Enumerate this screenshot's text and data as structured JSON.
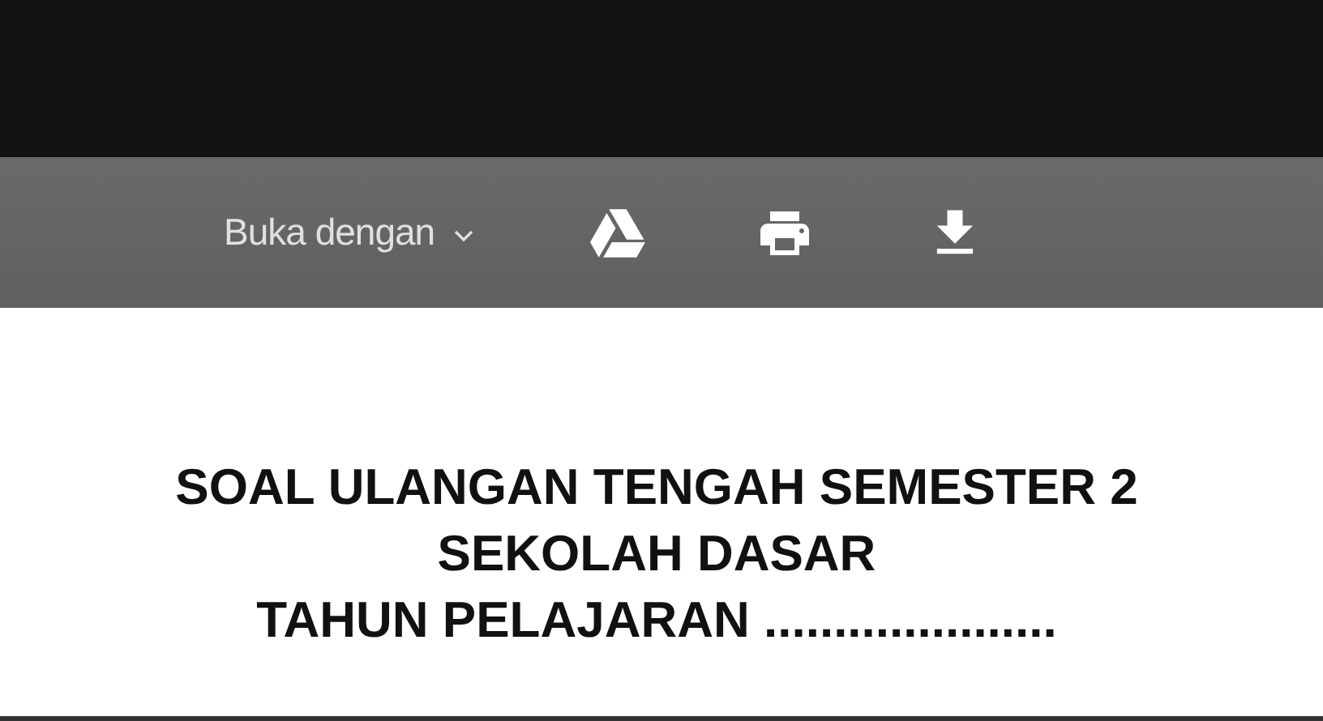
{
  "toolbar": {
    "open_with": {
      "label": "Buka dengan"
    }
  },
  "document": {
    "title_lines": [
      "SOAL ULANGAN TENGAH SEMESTER 2",
      "SEKOLAH DASAR",
      "TAHUN PELAJARAN ....................."
    ]
  }
}
